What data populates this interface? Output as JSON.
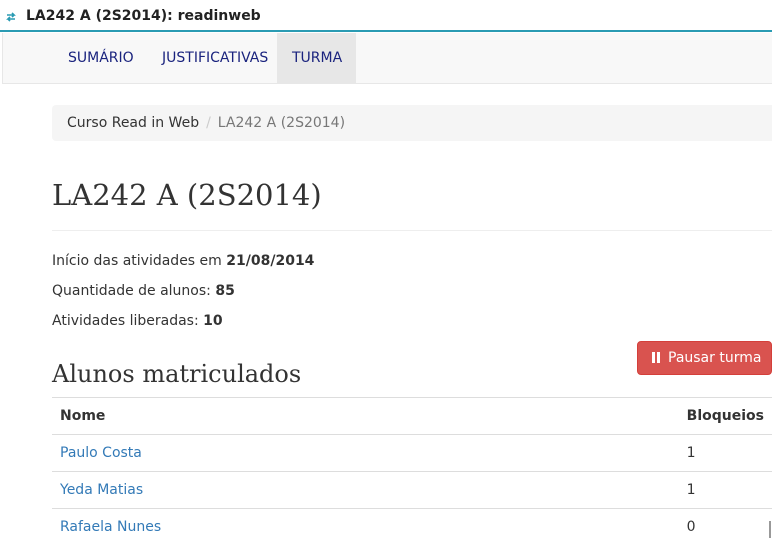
{
  "window": {
    "title": "LA242 A (2S2014): readinweb"
  },
  "nav": {
    "tabs": [
      {
        "label": "SUMÁRIO"
      },
      {
        "label": "JUSTIFICATIVAS"
      },
      {
        "label": "TURMA"
      }
    ],
    "active_tab": "TURMA"
  },
  "breadcrumb": {
    "items": [
      "Curso Read in Web",
      "LA242 A (2S2014)"
    ],
    "separator": "/"
  },
  "page": {
    "title": "LA242 A (2S2014)",
    "start_label": "Início das atividades em",
    "start_value": "21/08/2014",
    "students_label": "Quantidade de alunos:",
    "students_value": "85",
    "activities_label": "Atividades liberadas:",
    "activities_value": "10"
  },
  "actions": {
    "pause_label": "Pausar turma"
  },
  "enrolled": {
    "title": "Alunos matriculados",
    "columns": [
      "Nome",
      "Bloqueios"
    ],
    "rows": [
      {
        "name": "Paulo Costa",
        "blocks": "1"
      },
      {
        "name": "Yeda Matias",
        "blocks": "1"
      },
      {
        "name": "Rafaela Nunes",
        "blocks": "0"
      }
    ]
  },
  "colors": {
    "accent": "#2a9bb3",
    "nav_link": "#1a237e",
    "link": "#337ab7",
    "danger": "#d9534f"
  }
}
